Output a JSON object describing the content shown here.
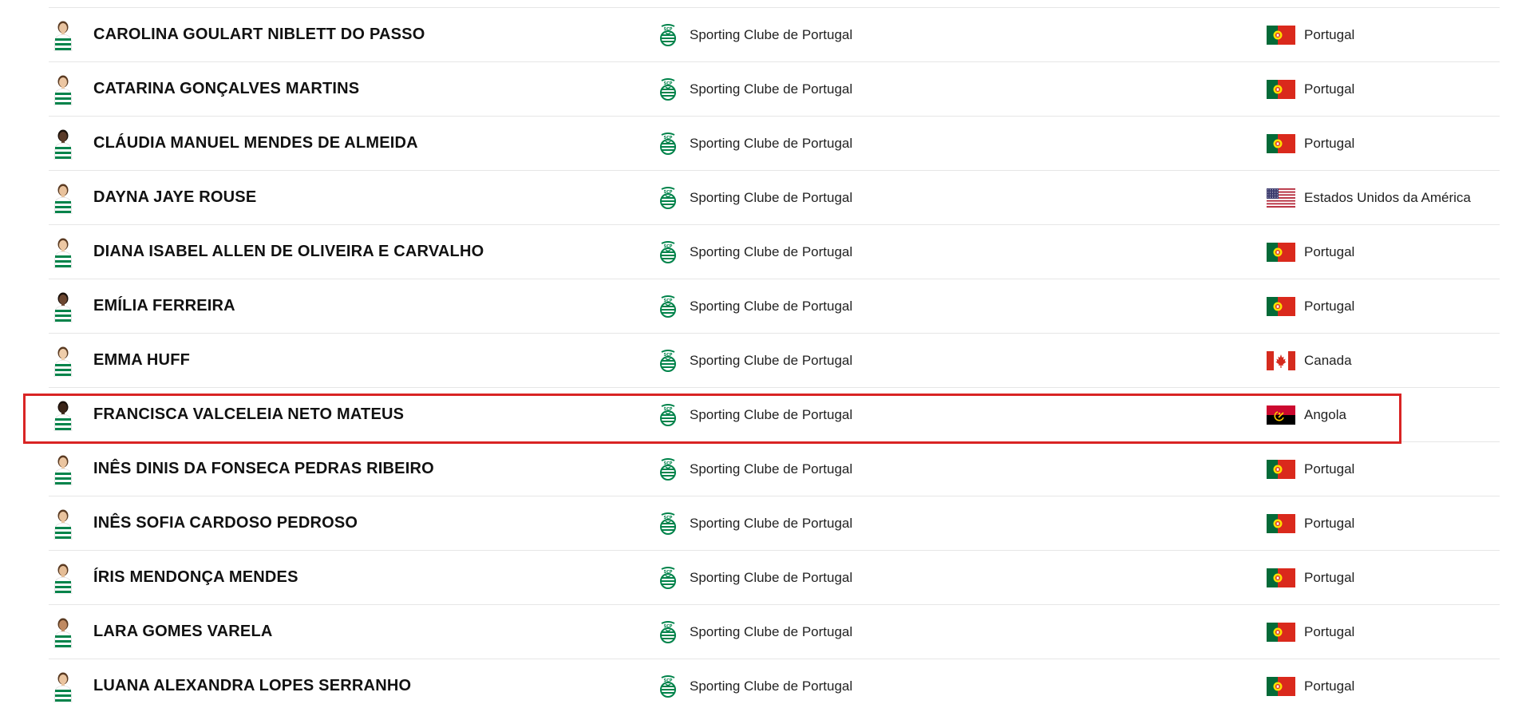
{
  "rows": [
    {
      "name": "CAROLINA GOULART NIBLETT DO PASSO",
      "club": "Sporting Clube de Portugal",
      "country": "Portugal",
      "flag": "portugal-flag-icon",
      "skin": "#e8c3a0"
    },
    {
      "name": "CATARINA GONÇALVES MARTINS",
      "club": "Sporting Clube de Portugal",
      "country": "Portugal",
      "flag": "portugal-flag-icon",
      "skin": "#ecc6a2"
    },
    {
      "name": "CLÁUDIA MANUEL MENDES DE ALMEIDA",
      "club": "Sporting Clube de Portugal",
      "country": "Portugal",
      "flag": "portugal-flag-icon",
      "skin": "#5a3a28"
    },
    {
      "name": "DAYNA JAYE ROUSE",
      "club": "Sporting Clube de Portugal",
      "country": "Estados Unidos da América",
      "flag": "usa-flag-icon",
      "skin": "#e9c29c"
    },
    {
      "name": "DIANA ISABEL ALLEN DE OLIVEIRA E CARVALHO",
      "club": "Sporting Clube de Portugal",
      "country": "Portugal",
      "flag": "portugal-flag-icon",
      "skin": "#edc8a4"
    },
    {
      "name": "EMÍLIA FERREIRA",
      "club": "Sporting Clube de Portugal",
      "country": "Portugal",
      "flag": "portugal-flag-icon",
      "skin": "#6b4630"
    },
    {
      "name": "EMMA HUFF",
      "club": "Sporting Clube de Portugal",
      "country": "Canada",
      "flag": "canada-flag-icon",
      "skin": "#efcdaa"
    },
    {
      "name": "FRANCISCA VALCELEIA NETO MATEUS",
      "club": "Sporting Clube de Portugal",
      "country": "Angola",
      "flag": "angola-flag-icon",
      "skin": "#3b2418"
    },
    {
      "name": "INÊS DINIS DA FONSECA PEDRAS RIBEIRO",
      "club": "Sporting Clube de Portugal",
      "country": "Portugal",
      "flag": "portugal-flag-icon",
      "skin": "#ebc5a0"
    },
    {
      "name": "INÊS SOFIA CARDOSO PEDROSO",
      "club": "Sporting Clube de Portugal",
      "country": "Portugal",
      "flag": "portugal-flag-icon",
      "skin": "#e9c39e"
    },
    {
      "name": "ÍRIS MENDONÇA MENDES",
      "club": "Sporting Clube de Portugal",
      "country": "Portugal",
      "flag": "portugal-flag-icon",
      "skin": "#e5bd96"
    },
    {
      "name": "LARA GOMES VARELA",
      "club": "Sporting Clube de Portugal",
      "country": "Portugal",
      "flag": "portugal-flag-icon",
      "skin": "#c08a62"
    },
    {
      "name": "LUANA ALEXANDRA LOPES SERRANHO",
      "club": "Sporting Clube de Portugal",
      "country": "Portugal",
      "flag": "portugal-flag-icon",
      "skin": "#eac49f"
    }
  ],
  "highlighted_row": 7,
  "colors": {
    "highlight_border": "#d92424",
    "sporting_green": "#00834a",
    "row_divider": "#e6e6e6"
  }
}
